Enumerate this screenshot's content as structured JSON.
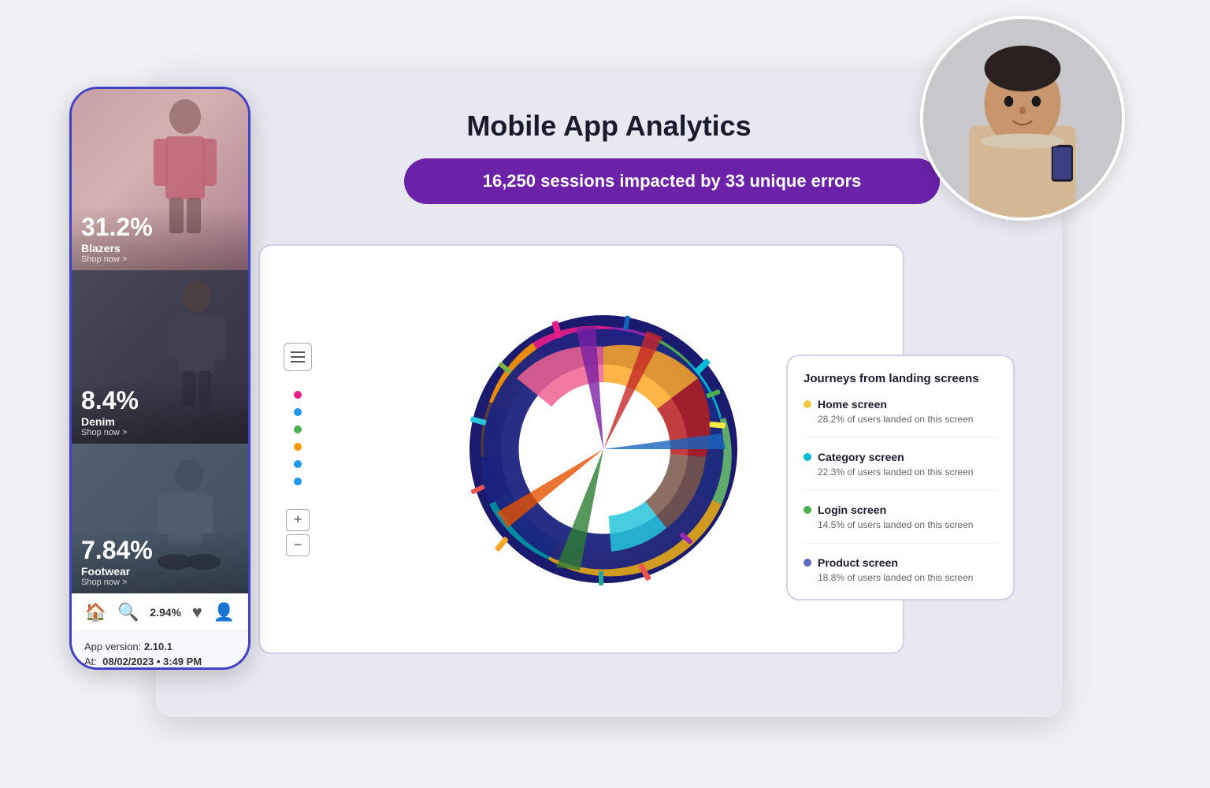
{
  "page": {
    "title": "Mobile App Analytics",
    "background_color": "#f0f0f5"
  },
  "sessions_banner": {
    "text": "16,250 sessions impacted by 33 unique errors",
    "bg_color": "#6b21a8"
  },
  "mobile_app": {
    "sections": [
      {
        "percent": "31.2%",
        "label": "Blazers",
        "sublabel": "Shop now >"
      },
      {
        "percent": "8.4%",
        "label": "Denim",
        "sublabel": "Shop now >"
      },
      {
        "percent": "7.84%",
        "label": "Footwear",
        "sublabel": "Shop now >"
      }
    ],
    "nav_percent": "2.94%",
    "app_version_label": "App version:",
    "app_version": "2.10.1",
    "at_label": "At:",
    "timestamp": "08/02/2023 • 3:49 PM"
  },
  "journey_panel": {
    "title": "Journeys from landing screens",
    "items": [
      {
        "name": "Home screen",
        "stat": "28.2% of users landed on this screen",
        "color": "#f5c842"
      },
      {
        "name": "Category screen",
        "stat": "22.3% of users landed on this screen",
        "color": "#00bcd4"
      },
      {
        "name": "Login screen",
        "stat": "14.5% of users landed on this screen",
        "color": "#4caf50"
      },
      {
        "name": "Product screen",
        "stat": "18.8% of users landed on this screen",
        "color": "#5c6bc0"
      }
    ]
  },
  "chart": {
    "zoom_plus": "+",
    "zoom_minus": "−",
    "dots": [
      {
        "color": "#e91e8c"
      },
      {
        "color": "#2196f3"
      },
      {
        "color": "#4caf50"
      },
      {
        "color": "#ff9800"
      },
      {
        "color": "#2196f3"
      },
      {
        "color": "#2196f3"
      }
    ]
  }
}
